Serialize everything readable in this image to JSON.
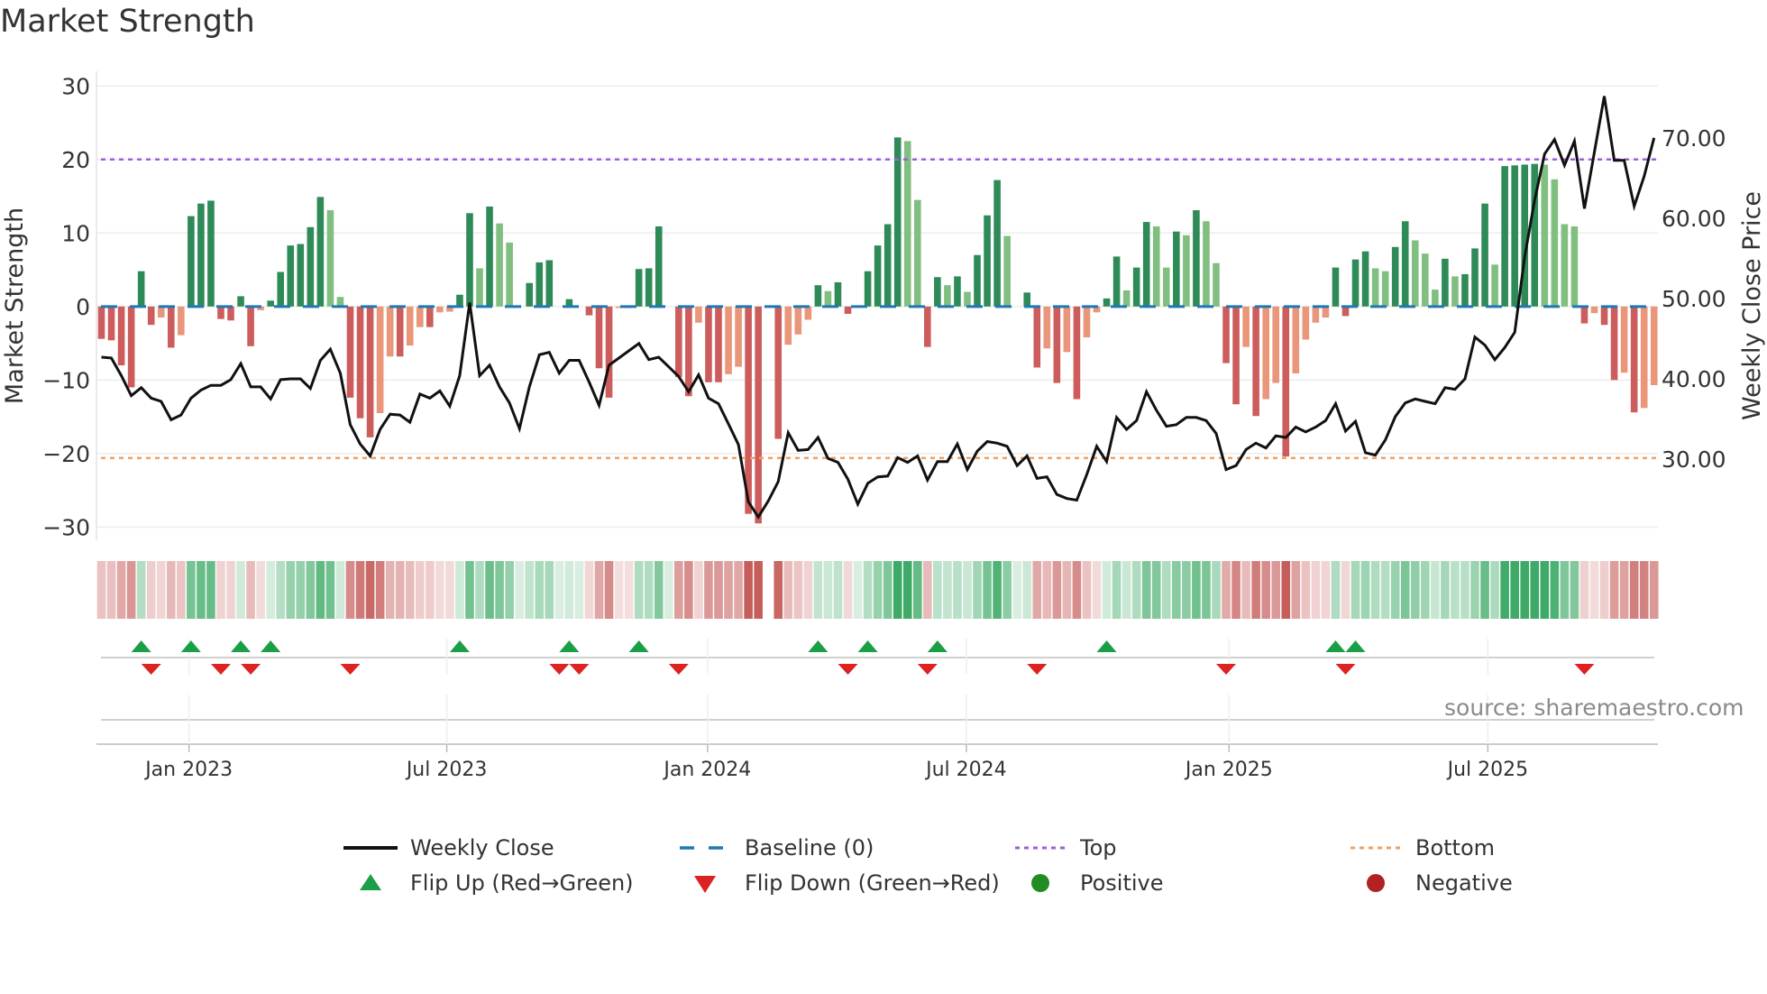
{
  "chart_data": {
    "type": "bar",
    "title": "Market Strength",
    "ylabel_left": "Market Strength",
    "ylabel_right": "Weekly Close Price",
    "ylim_left": [
      -31.8,
      32
    ],
    "ylim_right": [
      19.9,
      78.3
    ],
    "y_ticks_left": [
      {
        "value": 30,
        "label": "30"
      },
      {
        "value": 20,
        "label": "20"
      },
      {
        "value": 10,
        "label": "10"
      },
      {
        "value": 0,
        "label": "0"
      },
      {
        "value": -10,
        "label": "−10"
      },
      {
        "value": -20,
        "label": "−20"
      },
      {
        "value": -30,
        "label": "−30"
      }
    ],
    "y_ticks_right": [
      {
        "value": 70,
        "label": "70.00"
      },
      {
        "value": 60,
        "label": "60.00"
      },
      {
        "value": 50,
        "label": "50.00"
      },
      {
        "value": 40,
        "label": "40.00"
      },
      {
        "value": 30,
        "label": "30.00"
      }
    ],
    "x_unit": "week index",
    "x_ticks": [
      {
        "label": "Jan 2023",
        "week": 8.8
      },
      {
        "label": "Jul 2023",
        "week": 34.7
      },
      {
        "label": "Jan 2024",
        "week": 60.9
      },
      {
        "label": "Jul 2024",
        "week": 86.9
      },
      {
        "label": "Jan 2025",
        "week": 113.3
      },
      {
        "label": "Jul 2025",
        "week": 139.3
      }
    ],
    "top_level": 20,
    "bottom_level": -20.6,
    "baseline": 0,
    "grid": true,
    "legend_placement": "bottom",
    "series": [
      {
        "name": "Market Strength",
        "type": "bar",
        "values": [
          -4.4,
          -4.6,
          -8,
          -11,
          4.8,
          -2.5,
          -1.5,
          -5.6,
          -3.9,
          12.3,
          14,
          14.4,
          -1.7,
          -1.9,
          1.4,
          -5.4,
          -0.5,
          0.8,
          4.7,
          8.3,
          8.5,
          10.8,
          14.9,
          13.1,
          1.3,
          -12.4,
          -15.2,
          -17.8,
          -14.5,
          -6.8,
          -6.8,
          -5.3,
          -2.8,
          -2.8,
          -0.8,
          -0.7,
          1.6,
          12.7,
          5.2,
          13.6,
          11.3,
          8.7,
          0,
          3.2,
          6,
          6.3,
          0,
          1,
          0,
          -1.2,
          -8.4,
          -12.4,
          -0.2,
          -0.2,
          5.1,
          5.2,
          10.9,
          0,
          -9.6,
          -12.2,
          -2.2,
          -10.3,
          -10.3,
          -9.2,
          -8.2,
          -28.2,
          -29.5,
          0,
          -18,
          -5.2,
          -3.8,
          -1.8,
          2.9,
          2.1,
          3.3,
          -1,
          0,
          4.8,
          8.3,
          11.2,
          23,
          22.5,
          14.5,
          -5.5,
          4,
          2.9,
          4.1,
          2,
          7,
          12.4,
          17.2,
          9.6,
          0,
          1.9,
          -8.3,
          -5.7,
          -10.4,
          -6.2,
          -12.6,
          -4.2,
          -0.8,
          1.1,
          6.8,
          2.2,
          5.3,
          11.5,
          10.9,
          5.3,
          10.2,
          9.7,
          13.1,
          11.6,
          5.9,
          -7.7,
          -13.3,
          -5.5,
          -14.9,
          -12.6,
          -10.4,
          -20.4,
          -9.1,
          -4.5,
          -2.2,
          -1.5,
          5.3,
          -1.3,
          6.4,
          7.5,
          5.2,
          4.8,
          8.1,
          11.6,
          9,
          7.2,
          2.3,
          6.5,
          4.1,
          4.4,
          7.9,
          14,
          5.7,
          19.1,
          19.2,
          19.3,
          19.4,
          19.3,
          17.3,
          11.2,
          10.9,
          -2.3,
          -0.9,
          -2.5,
          -10,
          -9,
          -14.4,
          -13.8,
          -10.7
        ]
      },
      {
        "name": "Weekly Close",
        "type": "line",
        "axis": "right",
        "values": [
          42.7,
          42.6,
          40.4,
          37.9,
          38.9,
          37.6,
          37.2,
          34.9,
          35.5,
          37.6,
          38.6,
          39.2,
          39.2,
          39.9,
          41.9,
          39,
          39,
          37.5,
          39.9,
          40,
          40,
          38.8,
          42.3,
          43.7,
          40.7,
          34.3,
          31.9,
          30.4,
          33.7,
          35.6,
          35.5,
          34.6,
          38.1,
          37.6,
          38.5,
          36.6,
          40.4,
          49.5,
          40.4,
          41.7,
          39,
          37,
          33.8,
          39,
          43,
          43.3,
          40.7,
          42.3,
          42.3,
          39.6,
          36.7,
          41.7,
          42.6,
          43.5,
          44.4,
          42.4,
          42.7,
          41.5,
          40.3,
          38.4,
          40.5,
          37.6,
          36.9,
          34.4,
          31.8,
          24.7,
          22.8,
          24.8,
          27.2,
          33.3,
          31.1,
          31.2,
          32.7,
          30.1,
          29.6,
          27.5,
          24.4,
          27,
          27.8,
          27.9,
          30.2,
          29.6,
          30.4,
          27.4,
          29.7,
          29.7,
          31.9,
          28.7,
          31,
          32.2,
          32,
          31.6,
          29.2,
          30.4,
          27.6,
          27.8,
          25.6,
          25.1,
          24.9,
          28.1,
          31.6,
          29.7,
          35.2,
          33.7,
          34.8,
          38.4,
          36.1,
          34.1,
          34.3,
          35.2,
          35.2,
          34.8,
          33.2,
          28.7,
          29.2,
          31.2,
          32,
          31.4,
          32.9,
          32.7,
          34,
          33.4,
          34,
          34.8,
          36.9,
          33.5,
          34.7,
          30.8,
          30.5,
          32.4,
          35.3,
          37,
          37.5,
          37.2,
          36.9,
          38.9,
          38.7,
          40,
          45.2,
          44.2,
          42.4,
          43.9,
          45.8,
          55.2,
          62.3,
          68,
          69.8,
          66.6,
          69.6,
          61.2,
          68.2,
          75.2,
          67.2,
          67.2,
          61.5,
          65.2,
          70
        ]
      }
    ],
    "flip_up_weeks": [
      4,
      9,
      14,
      17,
      36,
      47,
      54,
      72,
      77,
      84,
      101,
      124,
      126
    ],
    "flip_down_weeks": [
      5,
      12,
      15,
      25,
      46,
      48,
      58,
      75,
      83,
      94,
      113,
      125,
      149
    ],
    "colors": {
      "bar_up_strong": "#2e8b57",
      "bar_up_weak": "#80bf80",
      "bar_down_strong": "#cd5c5c",
      "bar_down_weak": "#e9967a",
      "price_line": "#111111",
      "baseline": "#1f77b4",
      "top": "#9c5fe0",
      "bottom": "#f0a060",
      "flip_up": "#1a9e46",
      "flip_down": "#dd2222",
      "positive": "#228b22",
      "negative": "#b22222",
      "heat_pos": "#2ea35a",
      "heat_neg": "#c0504d"
    }
  },
  "legend": {
    "weekly_close": "Weekly Close",
    "baseline": "Baseline (0)",
    "top": "Top",
    "bottom": "Bottom",
    "flip_up": "Flip Up (Red→Green)",
    "flip_down": "Flip Down (Green→Red)",
    "positive": "Positive",
    "negative": "Negative"
  },
  "source": "source: sharemaestro.com"
}
